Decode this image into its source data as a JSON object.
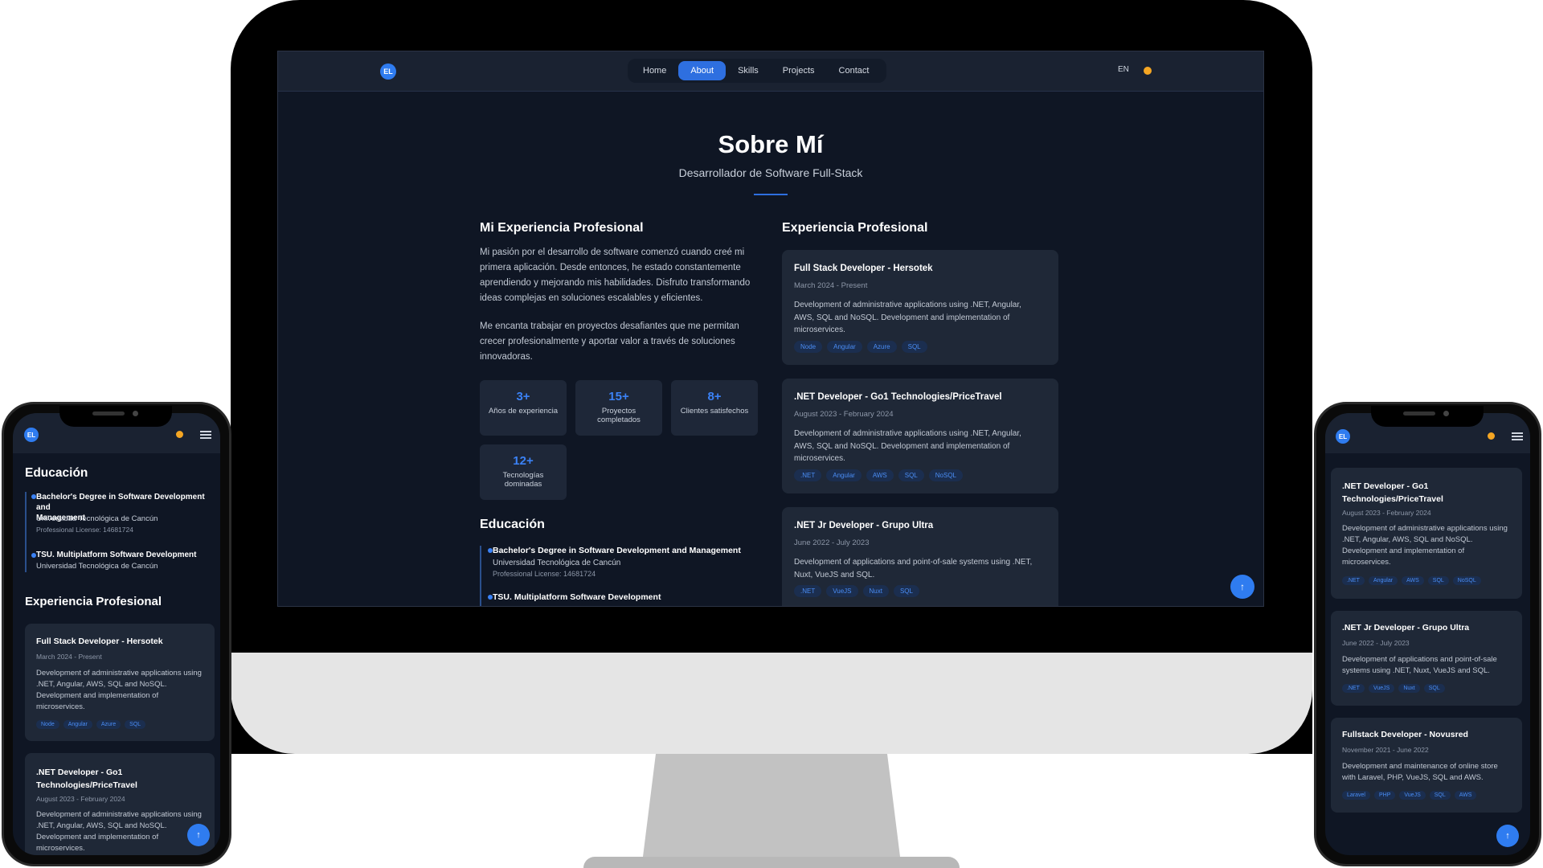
{
  "nav": {
    "logo": "EL",
    "items": [
      {
        "label": "Home",
        "active": false
      },
      {
        "label": "About",
        "active": true
      },
      {
        "label": "Skills",
        "active": false
      },
      {
        "label": "Projects",
        "active": false
      },
      {
        "label": "Contact",
        "active": false
      }
    ],
    "lang": "EN",
    "theme_icon": "sun-icon"
  },
  "about": {
    "title": "Sobre Mí",
    "subtitle": "Desarrollador de Software Full-Stack"
  },
  "experience_intro": {
    "heading": "Mi Experiencia Profesional",
    "p1_lines": [
      "Mi pasión por el desarrollo de software comenzó cuando creé mi",
      "primera aplicación. Desde entonces, he estado constantemente",
      "aprendiendo y mejorando mis habilidades. Disfruto transformando",
      "ideas complejas en soluciones escalables y eficientes."
    ],
    "p2_lines": [
      "Me encanta trabajar en proyectos desafiantes que me permitan",
      "crecer profesionalmente y aportar valor a través de soluciones",
      "innovadoras."
    ]
  },
  "stats": [
    {
      "num": "3+",
      "label1": "Años de experiencia",
      "label2": ""
    },
    {
      "num": "15+",
      "label1": "Proyectos",
      "label2": "completados"
    },
    {
      "num": "8+",
      "label1": "Clientes satisfechos",
      "label2": ""
    },
    {
      "num": "12+",
      "label1": "Tecnologías",
      "label2": "dominadas"
    }
  ],
  "education": {
    "heading": "Educación",
    "items": [
      {
        "degree": "Bachelor's Degree in Software Development and Management",
        "degree_l1": "Bachelor's Degree in Software Development and",
        "degree_l2": "Management",
        "school": "Universidad Tecnológica de Cancún",
        "license": "Professional License: 14681724"
      },
      {
        "degree": "TSU. Multiplatform Software Development",
        "school": "Universidad Tecnológica de Cancún",
        "license": ""
      }
    ]
  },
  "jobs_heading": "Experiencia Profesional",
  "jobs": [
    {
      "title": "Full Stack Developer - Hersotek",
      "title_l1": "Full Stack Developer - Hersotek",
      "title_l2": "",
      "dates": "March 2024 - Present",
      "desc_lines": [
        "Development of administrative applications using .NET, Angular,",
        "AWS, SQL and NoSQL. Development and implementation of",
        "microservices."
      ],
      "desc_lines_sm": [
        ".NET, Angular, AWS, SQL and NoSQL.",
        "Development and implementation of",
        "microservices."
      ],
      "tags": [
        "Node",
        "Angular",
        "Azure",
        "SQL"
      ]
    },
    {
      "title": ".NET Developer - Go1 Technologies/PriceTravel",
      "title_l1": ".NET Developer - Go1",
      "title_l2": "Technologies/PriceTravel",
      "dates": "August 2023 - February 2024",
      "desc_lines": [
        "Development of administrative applications using .NET, Angular,",
        "AWS, SQL and NoSQL. Development and implementation of",
        "microservices."
      ],
      "tags": [
        ".NET",
        "Angular",
        "AWS",
        "SQL",
        "NoSQL"
      ]
    },
    {
      "title": ".NET Jr Developer - Grupo Ultra",
      "dates": "June 2022 - July 2023",
      "desc_lines": [
        "Development of applications and point-of-sale systems using .NET,",
        "Nuxt, VueJS and SQL."
      ],
      "desc_lines_sm": [
        "Development of applications and point-of-sale",
        "systems using .NET, Nuxt, VueJS and SQL."
      ],
      "tags": [
        ".NET",
        "VueJS",
        "Nuxt",
        "SQL"
      ]
    },
    {
      "title": "Fullstack Developer - Novusred",
      "dates": "November 2021 - June 2022",
      "desc_lines": [
        "Development and maintenance of online store",
        "with Laravel, PHP, VueJS, SQL and AWS."
      ],
      "tags": [
        "Laravel",
        "PHP",
        "VueJS",
        "SQL",
        "AWS"
      ]
    }
  ],
  "mobile": {
    "desc_full_l1": "Development of administrative applications using",
    "desc_full_l2": ".NET, Angular, AWS, SQL and NoSQL.",
    "desc_full_l3": "Development and implementation of",
    "desc_full_l4": "microservices.",
    "edu_item1_l1": "Bachelor's Degree in Software Development and",
    "edu_item1_l2": "Management"
  },
  "scroll_top_icon": "arrow-up-icon",
  "menu_icon": "hamburger-icon"
}
